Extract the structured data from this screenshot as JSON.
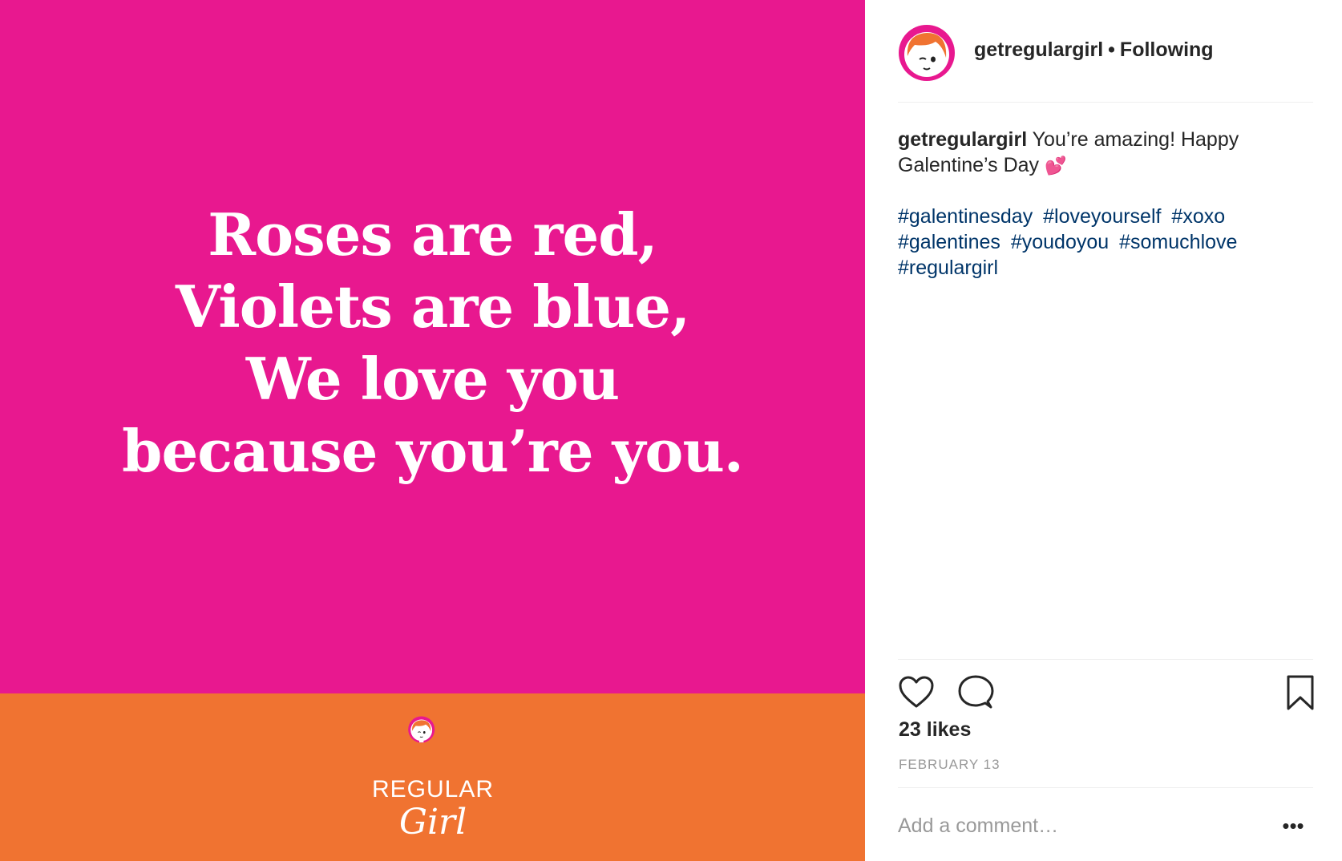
{
  "post": {
    "poem_lines": [
      "Roses are red,",
      "Violets are blue,",
      "We love you",
      "because you’re you."
    ],
    "brand": {
      "word": "REGULAR",
      "script": "Girl"
    },
    "colors": {
      "pink": "#e8188f",
      "orange": "#f07331"
    }
  },
  "header": {
    "username": "getregulargirl",
    "separator": "•",
    "follow_status": "Following"
  },
  "caption": {
    "username": "getregulargirl",
    "text": "You’re amazing! Happy Galentine’s Day",
    "emoji": "💕",
    "hashtags": [
      "#galentinesday",
      "#loveyourself",
      "#xoxo",
      "#galentines",
      "#youdoyou",
      "#somuchlove",
      "#regulargirl"
    ]
  },
  "actions": {
    "like_icon": "heart-icon",
    "comment_icon": "comment-bubble-icon",
    "save_icon": "bookmark-icon"
  },
  "stats": {
    "likes": "23 likes",
    "date": "FEBRUARY 13"
  },
  "comment": {
    "placeholder": "Add a comment…",
    "more_label": "•••"
  }
}
